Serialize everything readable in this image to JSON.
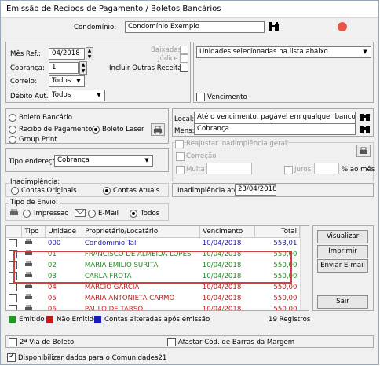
{
  "window": {
    "title": "Emissão de Recibos de Pagamento / Boletos Bancários"
  },
  "condominio": {
    "label": "Condomínio:",
    "value": "Condomínio Exemplo"
  },
  "filters": {
    "mes_ref_label": "Mês Ref.:",
    "mes_ref_value": "04/2018",
    "cobranca_label": "Cobrança:",
    "cobranca_value": "1",
    "correio_label": "Correio:",
    "correio_value": "Todos",
    "debito_label": "Débito Aut.:",
    "debito_value": "Todos",
    "baixadas_label": "Baixadas",
    "judice_label": "Júdice",
    "outras_receitas_label": "Incluir Outras Receitas"
  },
  "unidades": {
    "select_value": "Unidades selecionadas na lista abaixo",
    "vencimento_label": "Vencimento"
  },
  "print_type": {
    "options": [
      "Boleto Bancário",
      "Recibo de Pagamento",
      "Boleto Laser",
      "Group Print"
    ],
    "selected": "Boleto Laser"
  },
  "local": {
    "label": "Local:",
    "value": "Até o vencimento, pagável em qualquer banco."
  },
  "mens": {
    "label": "Mens:",
    "value": "Cobrança"
  },
  "reajustar": {
    "title": "Reajustar inadimplência geral:",
    "correcao": "Correção",
    "multa": "Multa",
    "juros": "Juros",
    "pct_label": "% ao mês"
  },
  "endereco": {
    "label": "Tipo endereço:",
    "value": "Cobrança"
  },
  "inadimplencia": {
    "title": "Inadimplência:",
    "opt1": "Contas Originais",
    "opt2": "Contas Atuais",
    "ate_label": "Inadimplência até:",
    "ate_value": "23/04/2018"
  },
  "envio": {
    "title": "Tipo de Envio:",
    "impressao": "Impressão",
    "email": "E-Mail",
    "todos": "Todos"
  },
  "table": {
    "headers": [
      "Tipo",
      "Unidade",
      "Proprietário/Locatário",
      "Vencimento",
      "Total"
    ],
    "rows": [
      {
        "unidade": "000",
        "nome": "Condominio Tal",
        "venc": "10/04/2018",
        "total": "553,01",
        "color": "#1a1ab8"
      },
      {
        "unidade": "01",
        "nome": "FRANCISCO DE ALMEIDA LOPES",
        "venc": "10/04/2018",
        "total": "550,00",
        "color": "#1f8a1f"
      },
      {
        "unidade": "02",
        "nome": "MARIA EMILIO SURITA",
        "venc": "10/04/2018",
        "total": "550,00",
        "color": "#1f8a1f"
      },
      {
        "unidade": "03",
        "nome": "CARLA FROTA",
        "venc": "10/04/2018",
        "total": "550,00",
        "color": "#1f8a1f"
      },
      {
        "unidade": "04",
        "nome": "MARCIO GARCIA",
        "venc": "10/04/2018",
        "total": "550,00",
        "color": "#c41a1a"
      },
      {
        "unidade": "05",
        "nome": "MARIA ANTONIETA CARMO",
        "venc": "10/04/2018",
        "total": "550,00",
        "color": "#c41a1a"
      },
      {
        "unidade": "06",
        "nome": "PAULO DE TARSO",
        "venc": "10/04/2018",
        "total": "550,00",
        "color": "#c41a1a"
      }
    ]
  },
  "buttons": {
    "visualizar": "Visualizar",
    "imprimir": "Imprimir",
    "enviar": "Enviar E-mail",
    "sair": "Sair"
  },
  "legend": {
    "emitido": "Emitido",
    "nao_emitido": "Não Emitido",
    "alteradas": "Contas alteradas após emissão",
    "registros": "19 Registros",
    "colors": {
      "emitido": "#1f9a1f",
      "nao_emitido": "#c41a1a",
      "alteradas": "#1a1ab8"
    }
  },
  "footer": {
    "segunda_via": "2ª Via de Boleto",
    "afastar": "Afastar Cód. de Barras da Margem",
    "disponibilizar": "Disponibilizar dados para o Comunidades21"
  }
}
